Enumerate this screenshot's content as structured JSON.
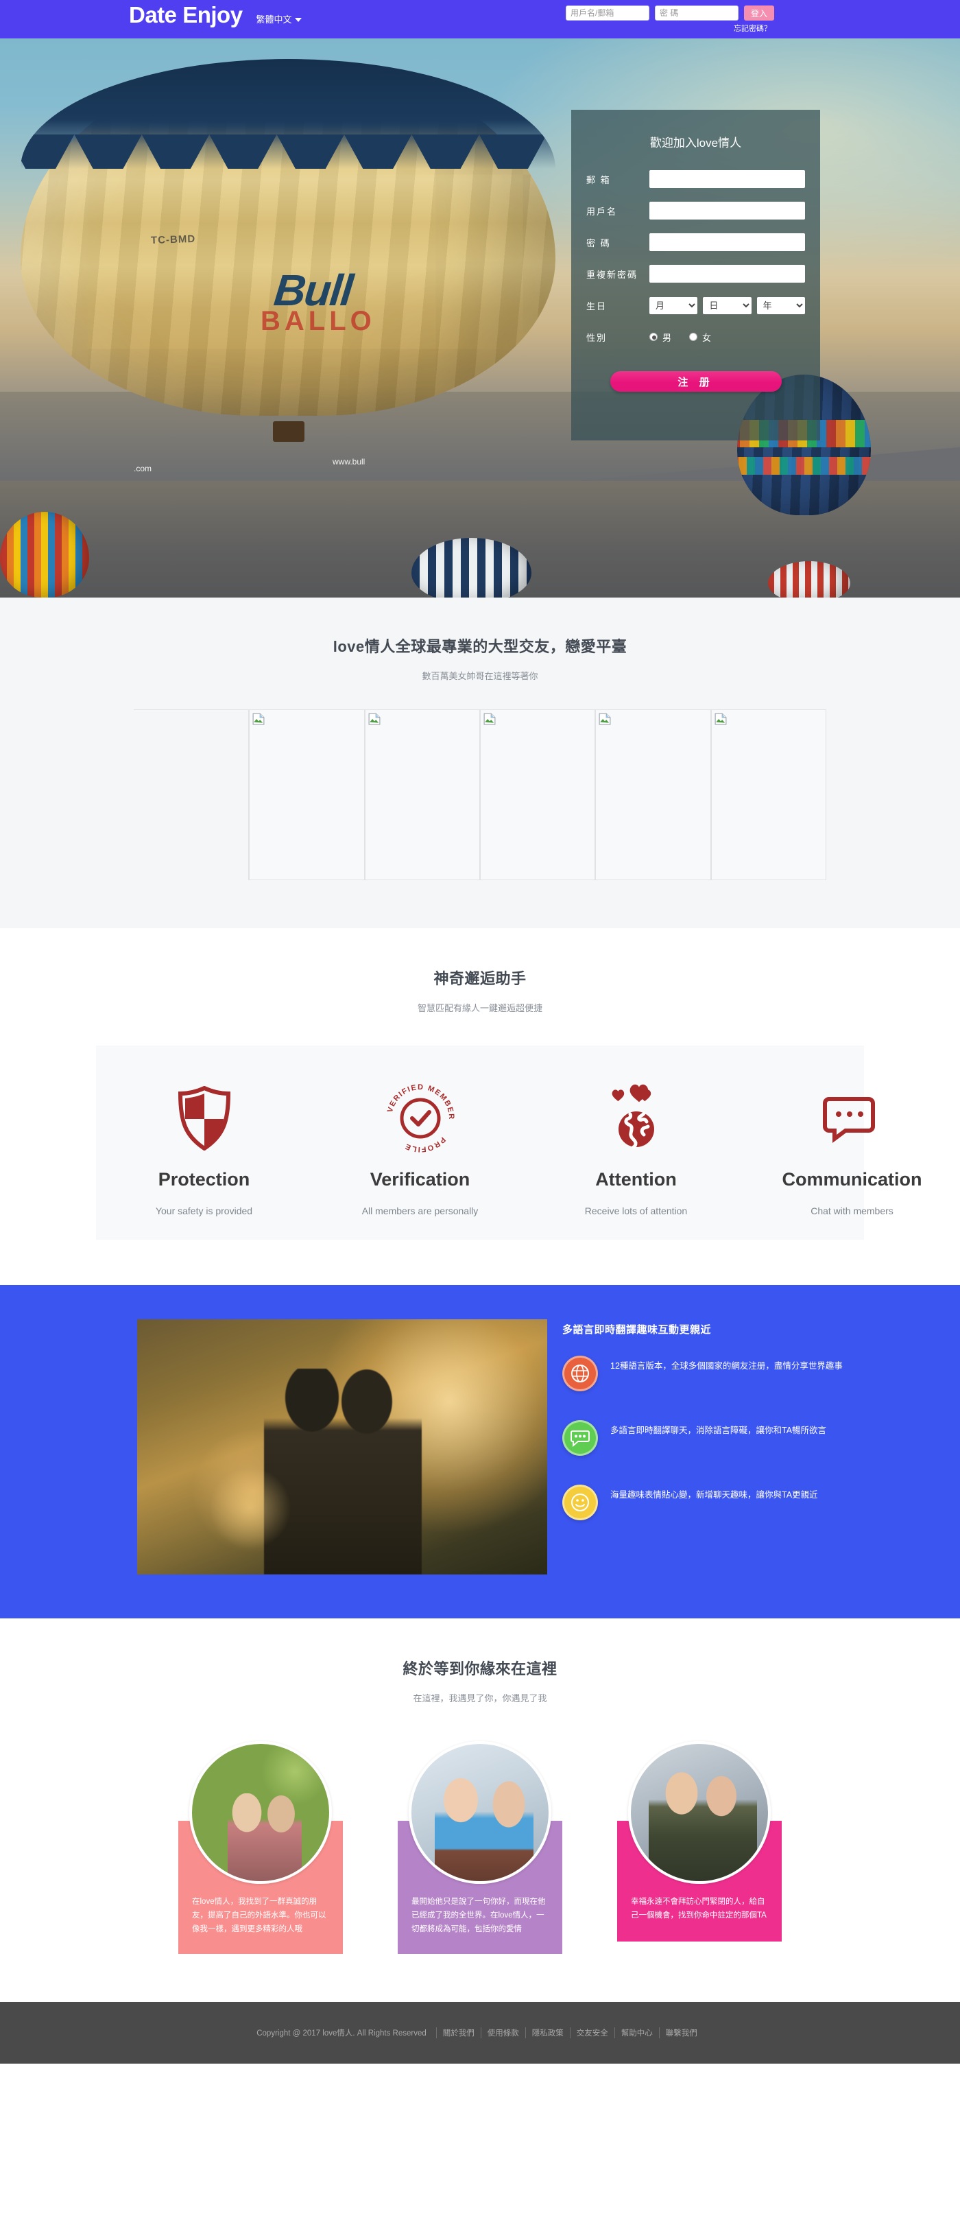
{
  "header": {
    "brand": "Date Enjoy",
    "language": "繁體中文",
    "login": {
      "username_placeholder": "用戶名/郵箱",
      "password_placeholder": "密 碼",
      "login_button": "登入",
      "forgot_password": "忘記密碼？"
    }
  },
  "register": {
    "title": "歡迎加入love情人",
    "fields": {
      "email_label": "郵 箱",
      "username_label": "用戶名",
      "password_label": "密 碼",
      "confirm_label": "重複新密碼",
      "birthday_label": "生日",
      "gender_label": "性別"
    },
    "birthday": {
      "month": "月",
      "day": "日",
      "year": "年"
    },
    "gender": {
      "male": "男",
      "female": "女",
      "selected": "男"
    },
    "submit": "注 册"
  },
  "gallery_section": {
    "title": "love情人全球最專業的大型交友，戀愛平臺",
    "subtitle": "數百萬美女帥哥在這裡等著你",
    "cells": [
      {
        "alt": "broken-image"
      },
      {
        "alt": "broken-image"
      },
      {
        "alt": "broken-image"
      },
      {
        "alt": "broken-image"
      },
      {
        "alt": "broken-image"
      },
      {
        "alt": "broken-image"
      }
    ]
  },
  "helper_section": {
    "title": "神奇邂逅助手",
    "subtitle": "智慧匹配有緣人一鍵邂逅超便捷",
    "items": [
      {
        "icon": "shield-icon",
        "title": "Protection",
        "desc": "Your safety is provided"
      },
      {
        "icon": "verified-badge-icon",
        "title": "Verification",
        "desc": "All members are personally"
      },
      {
        "icon": "globe-hearts-icon",
        "title": "Attention",
        "desc": "Receive lots of attention"
      },
      {
        "icon": "communication-icon",
        "title": "Communication",
        "desc": "Chat with members"
      }
    ]
  },
  "blue_section": {
    "title": "多語言即時翻譯趣味互動更親近",
    "photo_alt": "couple-sunset-photo",
    "features": [
      {
        "icon": "globe-icon",
        "color": "#e8603c",
        "text": "12種語言版本，全球多個國家的網友注册，盡情分享世界趣事"
      },
      {
        "icon": "chat-bubble-icon",
        "color": "#5fcc52",
        "text": "多語言即時翻譯聊天，消除語言障礙，讓你和TA暢所欲言"
      },
      {
        "icon": "smiley-icon",
        "color": "#f5cc3c",
        "text": "海量趣味表情貼心變，新增聊天趣味，讓你與TA更親近"
      }
    ]
  },
  "testimonials_section": {
    "title": "終於等到你緣來在這裡",
    "subtitle": "在這裡，我遇見了你，你遇見了我",
    "cards": [
      {
        "avatar_alt": "couple-picnic-photo",
        "text": "在love情人，我找到了一群真誠的朋友，提高了自己的外語水準。你也可以像我一樣，遇到更多精彩的人哦"
      },
      {
        "avatar_alt": "couple-embrace-photo",
        "text": "最開始他只是說了一句你好，而現在他已經成了我的全世界。在love情人，一切都將成為可能，包括你的愛情"
      },
      {
        "avatar_alt": "couple-kiss-photo",
        "text": "幸福永遠不會拜訪心門緊閉的人，給自己一個機會，找到你命中註定的那個TA"
      }
    ]
  },
  "footer": {
    "copyright": "Copyright @ 2017 love情人. All Rights Reserved",
    "links": [
      "關於我們",
      "使用條款",
      "隱私政策",
      "交友安全",
      "幫助中心",
      "聯繫我們"
    ]
  },
  "colors": {
    "nav_purple": "#4f3ff0",
    "blue_section": "#3b55f0",
    "accent_pink": "#e8147c",
    "login_pink": "#f48fb1",
    "icon_red": "#a72b2b"
  }
}
